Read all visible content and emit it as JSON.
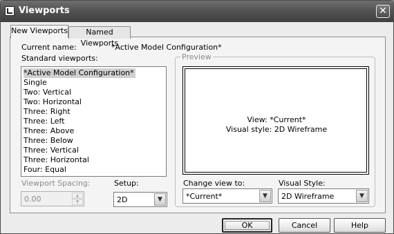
{
  "window": {
    "title": "Viewports",
    "close_icon": "close-icon"
  },
  "tabs": [
    {
      "label": "New Viewports",
      "active": true
    },
    {
      "label": "Named Viewports",
      "active": false
    }
  ],
  "current_name": {
    "label": "Current name:",
    "value": "*Active Model Configuration*"
  },
  "standard_viewports": {
    "label": "Standard viewports:",
    "items": [
      "*Active Model Configuration*",
      "Single",
      "Two:   Vertical",
      "Two:   Horizontal",
      "Three: Right",
      "Three: Left",
      "Three: Above",
      "Three: Below",
      "Three: Vertical",
      "Three: Horizontal",
      "Four:  Equal"
    ],
    "selected_index": 0
  },
  "preview": {
    "label": "Preview",
    "view_line": "View: *Current*",
    "style_line": "Visual style: 2D Wireframe"
  },
  "viewport_spacing": {
    "label": "Viewport Spacing:",
    "value": "0.00",
    "enabled": false
  },
  "setup": {
    "label": "Setup:",
    "value": "2D"
  },
  "change_view": {
    "label": "Change view to:",
    "value": "*Current*"
  },
  "visual_style": {
    "label": "Visual Style:",
    "value": "2D Wireframe"
  },
  "buttons": {
    "ok": "OK",
    "cancel": "Cancel",
    "help": "Help"
  },
  "colors": {
    "titlebar": "#545454",
    "dialog_bg": "#ececec",
    "panel_bg": "#f4f4f4",
    "selection": "#d0d0d0"
  }
}
